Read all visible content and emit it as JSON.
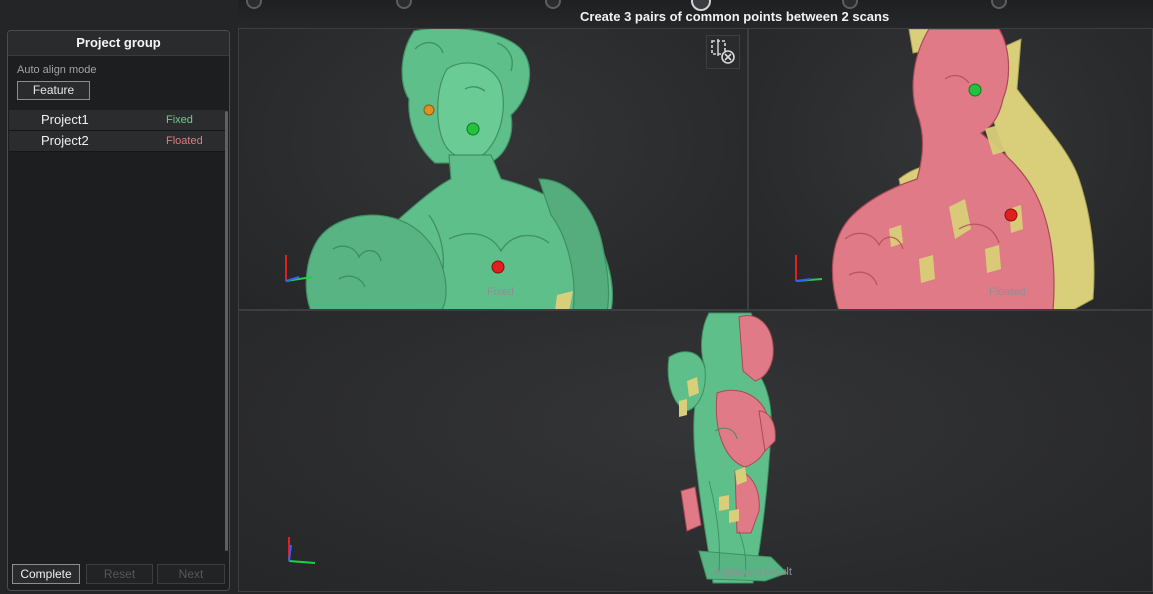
{
  "header": {
    "instruction": "Create 3 pairs of common points between 2 scans"
  },
  "sidebar": {
    "title": "Project group",
    "align_mode_label": "Auto align mode",
    "align_mode_value": "Feature",
    "projects": [
      {
        "name": "Project1",
        "status": "Fixed"
      },
      {
        "name": "Project2",
        "status": "Floated"
      }
    ],
    "buttons": {
      "complete": "Complete",
      "reset": "Reset",
      "next": "Next"
    }
  },
  "viewports": {
    "fixed_label": "Fixed",
    "floated_label": "Floated",
    "result_label": "Alignment result"
  },
  "icons": {
    "clear_points": "clear-points-icon",
    "axis": "axis-gizmo-icon"
  },
  "colors": {
    "fixed_scan": "#5fbf8a",
    "floated_scan": "#e07a86",
    "overlap_scan": "#d9cf7a",
    "point_green": "#22c23a",
    "point_red": "#e0201e",
    "point_orange": "#e0901e",
    "fixed_status": "#74c98a",
    "floated_status": "#e07a82"
  }
}
